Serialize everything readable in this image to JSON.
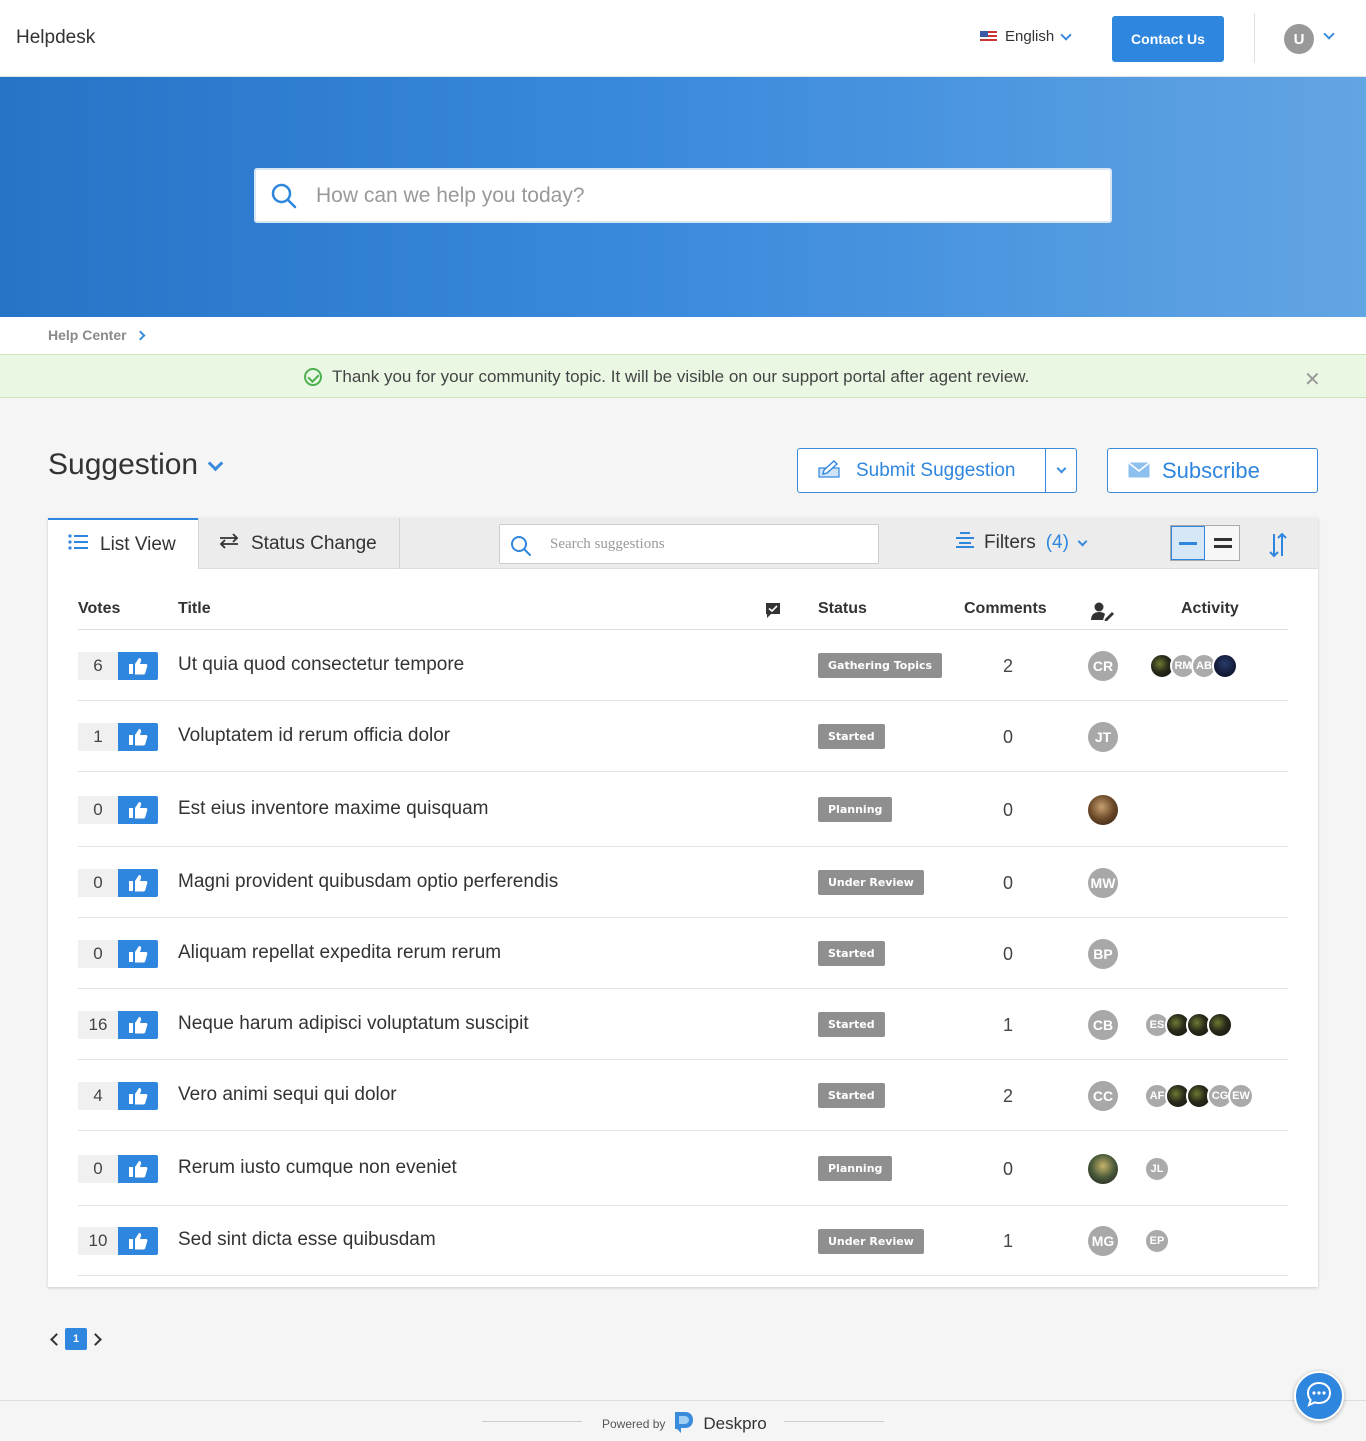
{
  "header": {
    "brand": "Helpdesk",
    "language": "English",
    "contact_label": "Contact Us",
    "user_initial": "U"
  },
  "hero": {
    "search_placeholder": "How can we help you today?"
  },
  "breadcrumb": {
    "items": [
      "Help Center"
    ]
  },
  "alert": {
    "message": "Thank you for your community topic. It will be visible on our support portal after agent review.",
    "type": "success"
  },
  "section": {
    "title": "Suggestion",
    "submit_label": "Submit Suggestion",
    "subscribe_label": "Subscribe"
  },
  "toolbar": {
    "tabs": [
      {
        "label": "List View",
        "active": true,
        "icon": "list-icon"
      },
      {
        "label": "Status Change",
        "active": false,
        "icon": "swap-arrows-icon"
      }
    ],
    "search_placeholder": "Search suggestions",
    "filters_label": "Filters",
    "filters_count": "(4)"
  },
  "table": {
    "columns": {
      "votes": "Votes",
      "title": "Title",
      "status": "Status",
      "comments": "Comments",
      "activity": "Activity"
    },
    "rows": [
      {
        "votes": "6",
        "title": "Ut quia quod consectetur tempore",
        "status": "Gathering Topics",
        "comments": "2",
        "assignee": "CR",
        "activity": [
          "photo",
          "RM",
          "AB",
          "navy"
        ]
      },
      {
        "votes": "1",
        "title": "Voluptatem id rerum officia dolor",
        "status": "Started",
        "comments": "0",
        "assignee": "JT",
        "activity": []
      },
      {
        "votes": "0",
        "title": "Est eius inventore maxime quisquam",
        "status": "Planning",
        "comments": "0",
        "assignee": "photo",
        "activity": []
      },
      {
        "votes": "0",
        "title": "Magni provident quibusdam optio perferendis",
        "status": "Under Review",
        "comments": "0",
        "assignee": "MW",
        "activity": []
      },
      {
        "votes": "0",
        "title": "Aliquam repellat expedita rerum rerum",
        "status": "Started",
        "comments": "0",
        "assignee": "BP",
        "activity": []
      },
      {
        "votes": "16",
        "title": "Neque harum adipisci voluptatum suscipit",
        "status": "Started",
        "comments": "1",
        "assignee": "CB",
        "activity": [
          "ES",
          "photo",
          "photo",
          "photo"
        ]
      },
      {
        "votes": "4",
        "title": "Vero animi sequi qui dolor",
        "status": "Started",
        "comments": "2",
        "assignee": "CC",
        "activity": [
          "AF",
          "photo",
          "photo",
          "CG",
          "EW"
        ]
      },
      {
        "votes": "0",
        "title": "Rerum iusto cumque non eveniet",
        "status": "Planning",
        "comments": "0",
        "assignee": "photo2",
        "activity": [
          "JL"
        ]
      },
      {
        "votes": "10",
        "title": "Sed sint dicta esse quibusdam",
        "status": "Under Review",
        "comments": "1",
        "assignee": "MG",
        "activity": [
          "EP"
        ]
      }
    ]
  },
  "pagination": {
    "current_page": "1"
  },
  "footer": {
    "powered_by": "Powered by",
    "product": "Deskpro"
  },
  "colors": {
    "accent": "#2f86de",
    "status_badge": "#8f8f8f",
    "alert_bg": "#eaf7e3"
  }
}
